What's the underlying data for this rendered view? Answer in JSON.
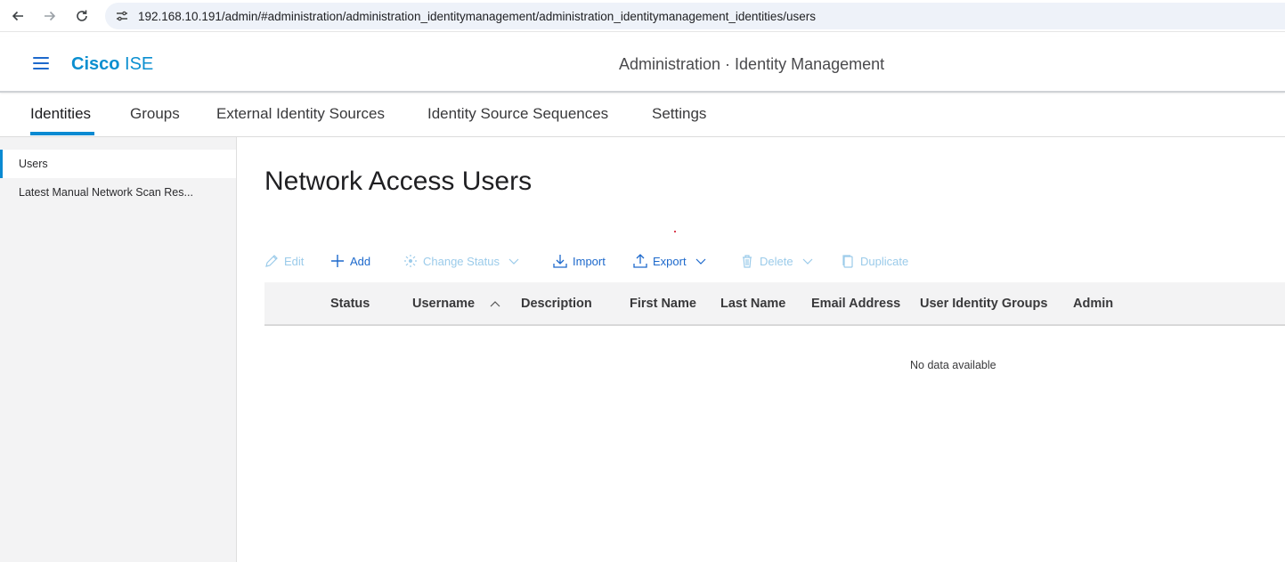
{
  "browser": {
    "url": "192.168.10.191/admin/#administration/administration_identitymanagement/administration_identitymanagement_identities/users",
    "icons": [
      "back-arrow-icon",
      "forward-arrow-icon",
      "reload-icon",
      "site-info-icon"
    ]
  },
  "header": {
    "brand_bold": "Cisco",
    "brand_light": " ISE",
    "title": "Administration · Identity Management"
  },
  "tabs": [
    {
      "label": "Identities",
      "active": true
    },
    {
      "label": "Groups"
    },
    {
      "label": "External Identity Sources"
    },
    {
      "label": "Identity Source Sequences"
    },
    {
      "label": "Settings"
    }
  ],
  "sidebar": {
    "items": [
      {
        "label": "Users",
        "active": true
      },
      {
        "label": "Latest Manual Network Scan Res..."
      }
    ]
  },
  "main": {
    "title": "Network Access Users",
    "toolbar": {
      "edit": "Edit",
      "add": "Add",
      "change_status": "Change Status",
      "import": "Import",
      "export": "Export",
      "delete": "Delete",
      "duplicate": "Duplicate"
    },
    "table": {
      "columns": [
        "Status",
        "Username",
        "Description",
        "First Name",
        "Last Name",
        "Email Address",
        "User Identity Groups",
        "Admin"
      ],
      "sorted_by": "Username",
      "rows": [],
      "empty_message": "No data available"
    }
  },
  "colors": {
    "accent": "#0a8ad2",
    "link": "#1d69cc",
    "disabled_link": "#9bcbea"
  }
}
